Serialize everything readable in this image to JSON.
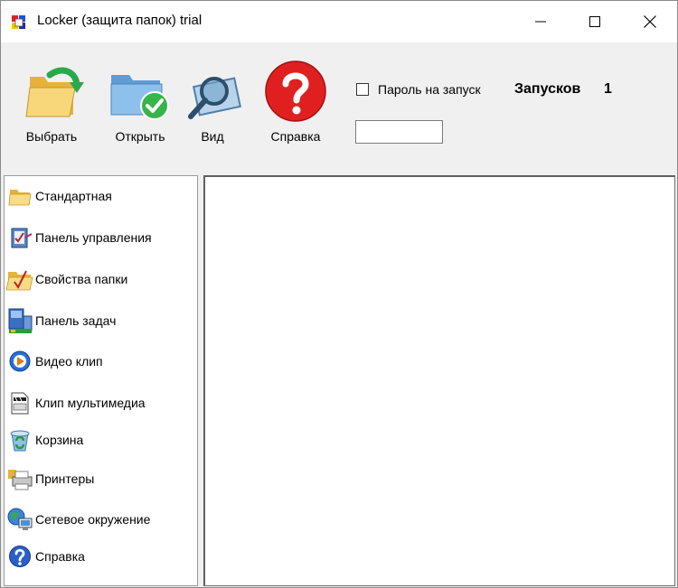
{
  "window": {
    "title": "Locker (защита папок) trial"
  },
  "toolbar": {
    "buttons": [
      {
        "label": "Выбрать",
        "icon": "folder-arrow-icon"
      },
      {
        "label": "Открыть",
        "icon": "folder-check-icon"
      },
      {
        "label": "Вид",
        "icon": "magnifier-icon"
      },
      {
        "label": "Справка",
        "icon": "help-question-icon"
      }
    ],
    "password_on_start": {
      "label": "Пароль на запуск",
      "checked": false
    },
    "runs_label": "Запусков",
    "runs_count": "1",
    "password_value": ""
  },
  "sidebar": {
    "items": [
      {
        "label": "Стандартная",
        "icon": "folder-icon"
      },
      {
        "label": "Панель управления",
        "icon": "control-panel-icon"
      },
      {
        "label": "Свойства папки",
        "icon": "folder-properties-icon"
      },
      {
        "label": "Панель задач",
        "icon": "taskbar-icon"
      },
      {
        "label": "Видео клип",
        "icon": "video-clip-icon"
      },
      {
        "label": "Клип мультимедиа",
        "icon": "multimedia-clip-icon"
      },
      {
        "label": "Корзина",
        "icon": "recycle-bin-icon"
      },
      {
        "label": "Принтеры",
        "icon": "printer-icon"
      },
      {
        "label": "Сетевое окружение",
        "icon": "network-icon"
      },
      {
        "label": "Справка",
        "icon": "help-icon"
      }
    ]
  }
}
